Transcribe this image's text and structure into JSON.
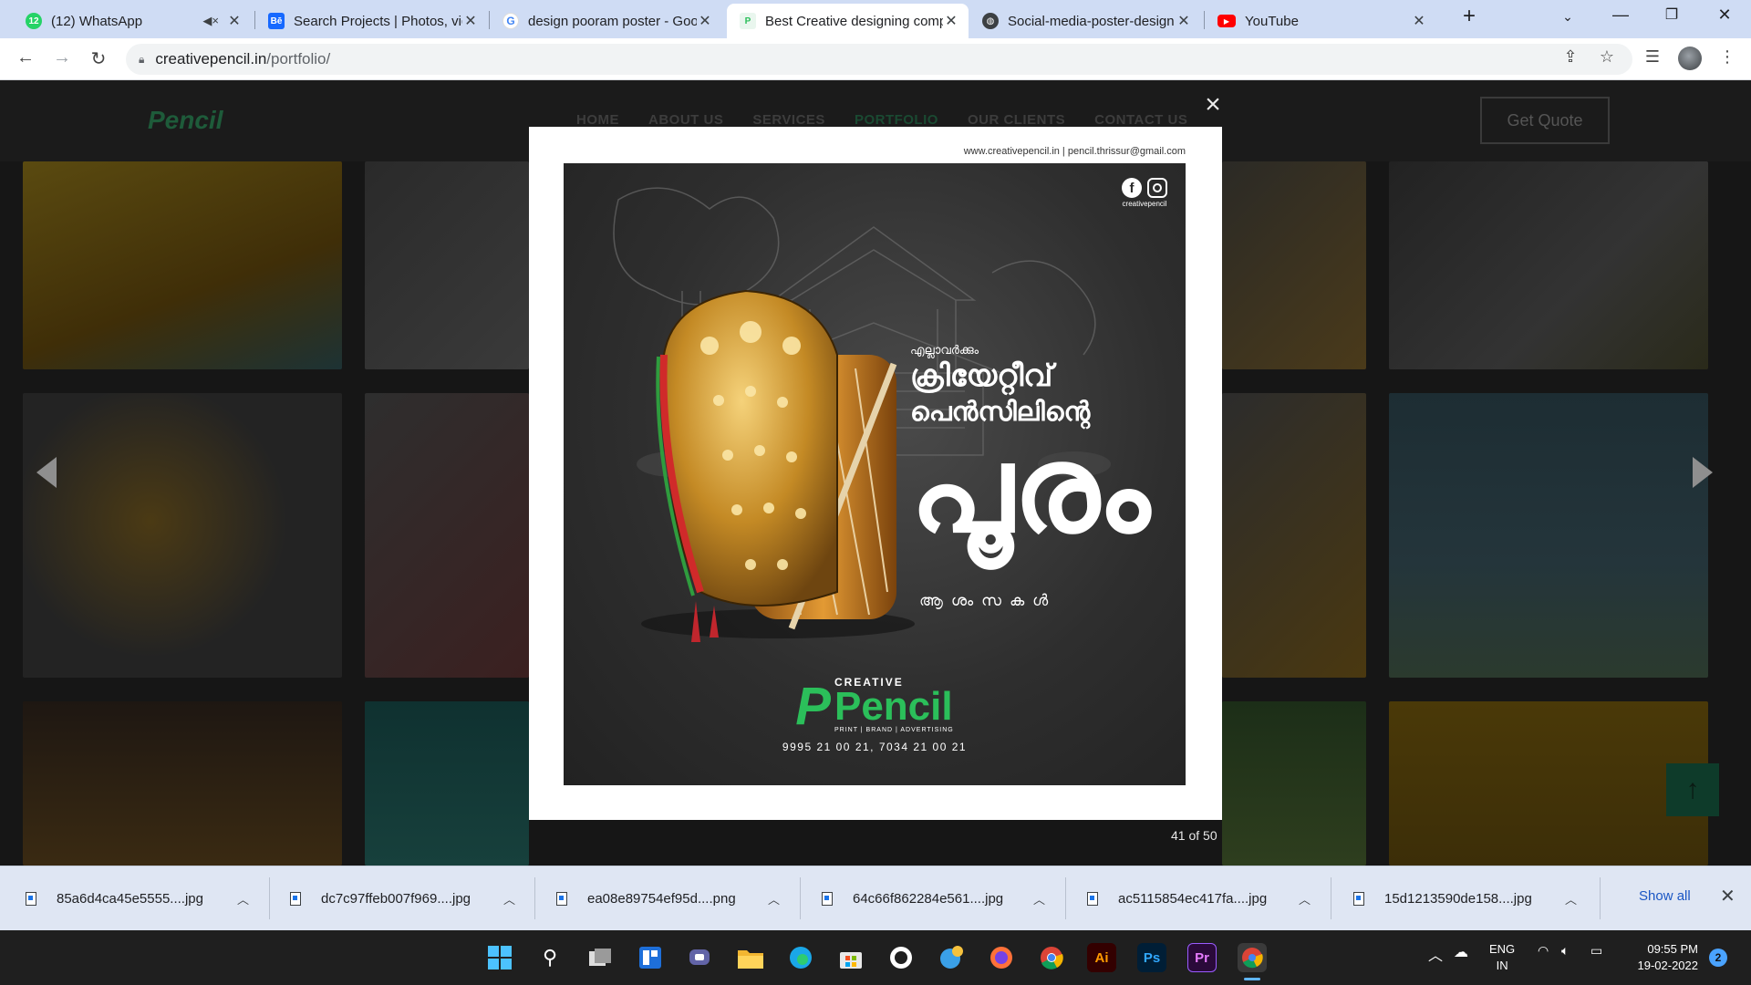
{
  "browser": {
    "tabs": [
      {
        "title": "(12) WhatsApp",
        "favicon": "whatsapp-icon"
      },
      {
        "title": "Search Projects | Photos, videos",
        "favicon": "behance-icon"
      },
      {
        "title": "design pooram poster - Google",
        "favicon": "google-icon"
      },
      {
        "title": "Best Creative designing company",
        "favicon": "creative-pencil-icon"
      },
      {
        "title": "Social-media-poster-design",
        "favicon": "globe-icon"
      },
      {
        "title": "YouTube",
        "favicon": "youtube-icon"
      }
    ],
    "active_tab_index": 3,
    "url_host": "creativepencil.in",
    "url_path": "/portfolio/"
  },
  "site": {
    "logo_text": "Pencil",
    "nav": [
      "HOME",
      "ABOUT US",
      "SERVICES",
      "PORTFOLIO",
      "OUR CLIENTS",
      "CONTACT US"
    ],
    "active_nav": "PORTFOLIO",
    "cta": "Get Quote"
  },
  "lightbox": {
    "close_glyph": "×",
    "contact_line": "www.creativepencil.in  |  pencil.thrissur@gmail.com",
    "counter": "41 of 50",
    "poster": {
      "social_handle": "creativepencil",
      "line1": "എല്ലാവർക്കും",
      "line2": "ക്രിയേറ്റീവ്",
      "line3": "പെൻസിലിന്റെ",
      "big": "പൂരം",
      "wishes": "ആശംസകൾ",
      "brand_creative": "CREATIVE",
      "brand_pencil": "Pencil",
      "brand_tagline": "PRINT | BRAND | ADVERTISING",
      "phone": "9995 21 00 21, 7034 21 00 21"
    }
  },
  "downloads": {
    "items": [
      "85a6d4ca45e5555....jpg",
      "dc7c97ffeb007f969....jpg",
      "ea08e89754ef95d....png",
      "64c66f862284e561....jpg",
      "ac5115854ec417fa....jpg",
      "15d1213590de158....jpg"
    ],
    "show_all": "Show all"
  },
  "taskbar": {
    "lang_top": "ENG",
    "lang_bottom": "IN",
    "time": "09:55 PM",
    "date": "19-02-2022",
    "notification_count": "2"
  }
}
